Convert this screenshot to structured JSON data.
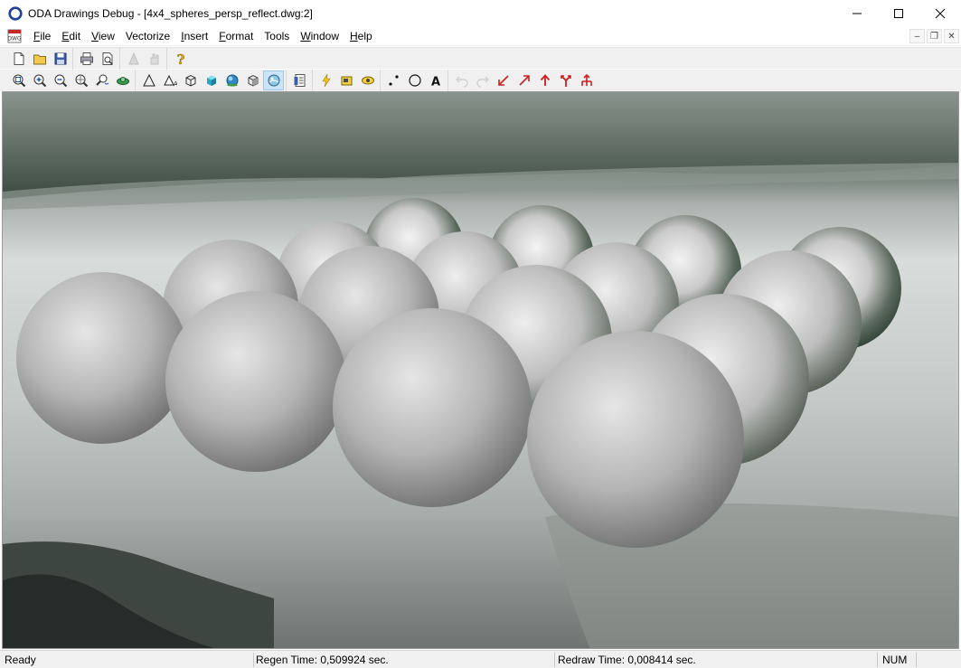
{
  "window": {
    "title": "ODA Drawings Debug - [4x4_spheres_persp_reflect.dwg:2]",
    "controls": {
      "minimize": "—",
      "maximize": "☐",
      "close": "✕"
    }
  },
  "menu": {
    "items": [
      {
        "label": "File",
        "key": "F",
        "rest": "ile"
      },
      {
        "label": "Edit",
        "key": "E",
        "rest": "dit"
      },
      {
        "label": "View",
        "key": "V",
        "rest": "iew"
      },
      {
        "label": "Vectorize",
        "key": "",
        "rest": "Vectorize"
      },
      {
        "label": "Insert",
        "key": "I",
        "rest": "nsert"
      },
      {
        "label": "Format",
        "key": "F",
        "rest": "ormat"
      },
      {
        "label": "Tools",
        "key": "",
        "rest": "Tools"
      },
      {
        "label": "Window",
        "key": "W",
        "rest": "indow"
      },
      {
        "label": "Help",
        "key": "H",
        "rest": "elp"
      }
    ],
    "mdi": {
      "minimize": "–",
      "restore": "❐",
      "close": "✕"
    }
  },
  "toolbar1": {
    "groups": [
      [
        "new-icon",
        "open-icon",
        "save-icon"
      ],
      [
        "print-icon",
        "print-preview-icon"
      ],
      [
        "pick-icon",
        "hand-icon"
      ],
      [
        "help-icon"
      ]
    ]
  },
  "toolbar2": {
    "groups": [
      [
        "zoom-extents-icon",
        "zoom-in-icon",
        "zoom-out-icon",
        "zoom-window-icon",
        "zoom-dynamic-icon",
        "orbit-icon"
      ],
      [
        "wireframe-2d-icon",
        "hidden-line-icon",
        "wireframe-3d-icon",
        "flat-shaded-icon",
        "gouraud-shaded-icon",
        "box-view-icon",
        "render-icon"
      ],
      [
        "properties-icon"
      ],
      [
        "lightning-icon",
        "layer-icon",
        "eye-icon"
      ],
      [
        "point-icon",
        "circle-icon",
        "text-icon"
      ],
      [
        "undo-icon",
        "redo-icon",
        "arrow-sw-icon",
        "arrow-ne-icon",
        "arrow-up-icon",
        "fork-icon",
        "tree-icon"
      ]
    ],
    "pressed": "render-icon"
  },
  "status": {
    "ready": "Ready",
    "regen": "Regen Time: 0,509924 sec.",
    "redraw": "Redraw Time: 0,008414 sec.",
    "num": "NUM"
  },
  "colors": {
    "accent_blue": "#1f4ea8",
    "toolbar_bg": "#f0f0f0",
    "pressed_bg": "#cce4f7"
  }
}
